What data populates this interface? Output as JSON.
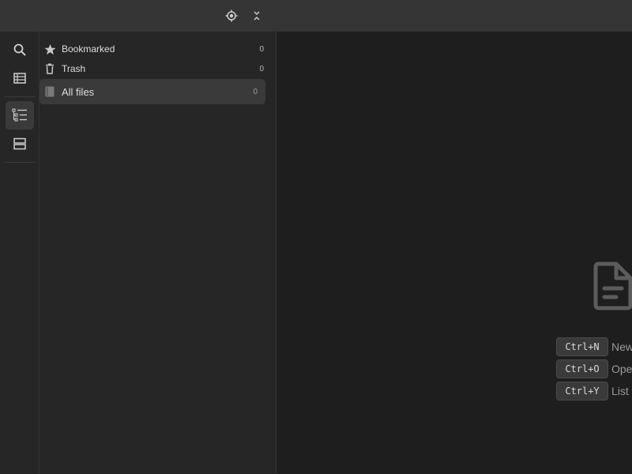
{
  "topbar": {
    "icons": [
      "crosshair-icon",
      "collapse-all-icon"
    ]
  },
  "ribbon": {
    "items": [
      {
        "name": "search",
        "icon": "search-icon"
      },
      {
        "name": "table",
        "icon": "table-icon"
      },
      {
        "name": "outline",
        "icon": "tree-list-icon",
        "active": true
      },
      {
        "name": "layout",
        "icon": "split-rows-icon"
      }
    ]
  },
  "sidebar": {
    "items": [
      {
        "label": "Bookmarked",
        "count": "0",
        "icon": "star-icon"
      },
      {
        "label": "Trash",
        "count": "0",
        "icon": "trash-icon"
      },
      {
        "label": "All files",
        "count": "0",
        "icon": "book-icon",
        "selected": true
      }
    ]
  },
  "main": {
    "empty_icon": "document-icon",
    "shortcuts": [
      {
        "key": "Ctrl+N",
        "label": "New"
      },
      {
        "key": "Ctrl+O",
        "label": "Open"
      },
      {
        "key": "Ctrl+Y",
        "label": "List"
      }
    ]
  },
  "colors": {
    "background": "#1e1e1e",
    "panel": "#262626",
    "topbar": "#353535",
    "selected": "#3a3a3a",
    "muted_text": "#9a9a9a"
  }
}
